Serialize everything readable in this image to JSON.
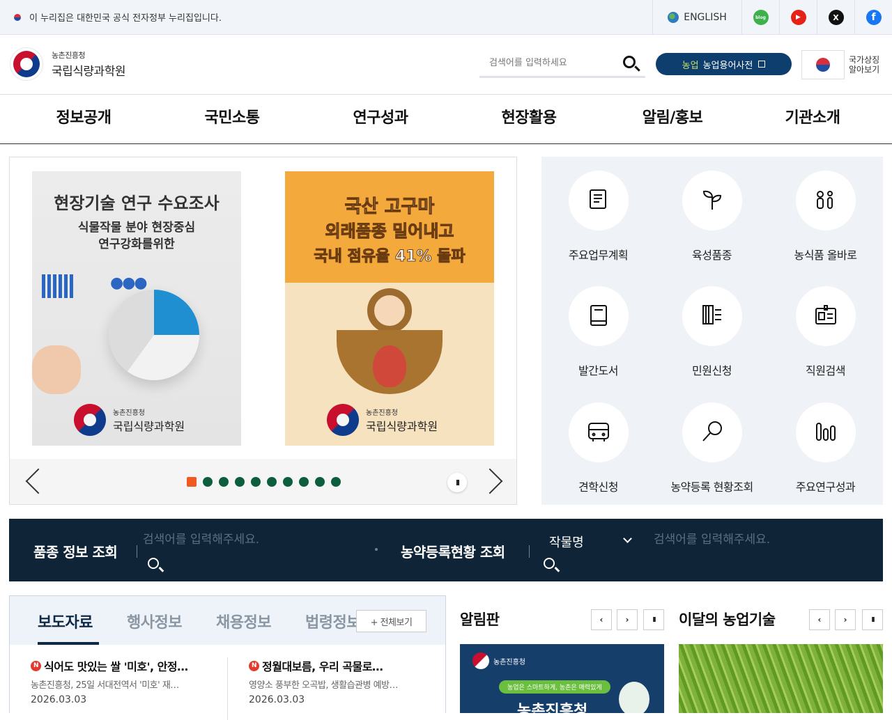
{
  "topbar": {
    "gov_notice": "이 누리집은 대한민국 공식 전자정부 누리집입니다.",
    "english": "ENGLISH",
    "sns": [
      {
        "name": "blog",
        "glyph": "blog",
        "color": "#3db24b"
      },
      {
        "name": "youtube",
        "glyph": "▶",
        "color": "#e62117"
      },
      {
        "name": "x",
        "glyph": "X",
        "color": "#111111"
      },
      {
        "name": "facebook",
        "glyph": "f",
        "color": "#1877f2"
      }
    ]
  },
  "header": {
    "logo_sub": "농촌진흥청",
    "logo_main": "국립식량과학원",
    "search_placeholder": "검색어를 입력하세요",
    "dict_label": "농업용어사전",
    "dict_brand": "농업",
    "national_symbol": "국가상징\n알아보기"
  },
  "gnb": [
    "정보공개",
    "국민소통",
    "연구성과",
    "현장활용",
    "알림/홍보",
    "기관소개"
  ],
  "slider": {
    "slide1": {
      "title": "현장기술 연구 수요조사",
      "sub1": "식물작물 분야 현장중심",
      "sub2": "연구강화를위한",
      "inst_sub": "농촌진흥청",
      "inst_main": "국립식량과학원"
    },
    "slide2": {
      "line1": "국산 고구마",
      "line2": "외래품종 밀어내고",
      "line3": "국내 점유율 41% 돌파",
      "inst_sub": "농촌진흥청",
      "inst_main": "국립식량과학원"
    },
    "dot_count": 10,
    "active_dot": 0,
    "pause": "II"
  },
  "quick": [
    {
      "label": "주요업무계획",
      "icon": "document-icon"
    },
    {
      "label": "육성품종",
      "icon": "sprout-icon"
    },
    {
      "label": "농식품 올바로",
      "icon": "people-icon"
    },
    {
      "label": "발간도서",
      "icon": "book-icon"
    },
    {
      "label": "민원신청",
      "icon": "form-icon"
    },
    {
      "label": "직원검색",
      "icon": "id-card-icon"
    },
    {
      "label": "견학신청",
      "icon": "bus-icon"
    },
    {
      "label": "농약등록 현황조회",
      "icon": "magnifier-icon"
    },
    {
      "label": "주요연구성과",
      "icon": "bar-chart-icon"
    }
  ],
  "searchbar": {
    "variety_label": "품종 정보 조회",
    "variety_placeholder": "검색어를 입력해주세요.",
    "pesticide_label": "농약등록현황 조회",
    "crop_select": "작물명",
    "pesticide_placeholder": "검색어를 입력해주세요."
  },
  "news": {
    "tabs": [
      "보도자료",
      "행사정보",
      "채용정보",
      "법령정보"
    ],
    "more": "+ 전체보기",
    "items": [
      {
        "badge": "N",
        "title": "식어도 맛있는 쌀 '미호', 안정…",
        "desc": "농촌진흥청, 25일 서대전역서 '미호' 재…",
        "date": "2026.03.03"
      },
      {
        "badge": "N",
        "title": "정월대보름, 우리 곡물로…",
        "desc": "영양소 풍부한 오곡밥, 생활습관병 예방…",
        "date": "2026.03.03"
      }
    ]
  },
  "board": {
    "title": "알림판",
    "banner_sub": "농촌진흥청",
    "banner_text": "농업은 스마트하게, 농촌은 매력있게",
    "banner_big": "농촌진흥청"
  },
  "tech": {
    "title": "이달의 농업기술"
  },
  "controls": {
    "prev": "‹",
    "next": "›",
    "pause": "II"
  }
}
